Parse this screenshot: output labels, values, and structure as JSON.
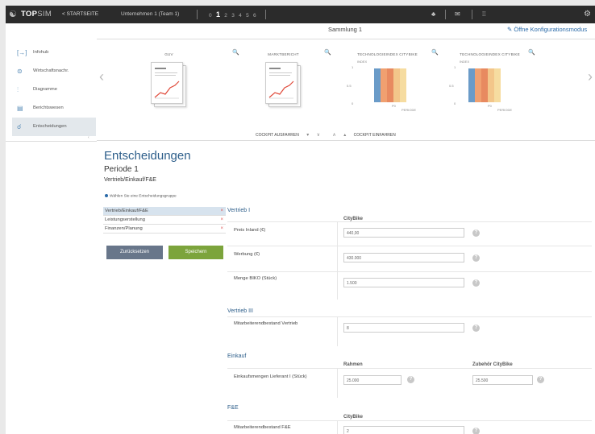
{
  "topbar": {
    "logo_icon": "people-icon",
    "logo_bold": "TOP",
    "logo_rest": "SIM",
    "start_link": "< STARTSEITE",
    "company": "Unternehmen 1 (Team 1)",
    "periods": [
      "0",
      "1",
      "2",
      "3",
      "4",
      "5",
      "6"
    ],
    "current_period": "1",
    "network_icon": "♣",
    "mail_icon": "✉",
    "chart_icon": "⁞⁞",
    "gear_icon": "⚙"
  },
  "collection": {
    "title": "Sammlung 1",
    "config_link": "✎ Öffne Konfigurationsmodus"
  },
  "sidebar": {
    "items": [
      {
        "icon": "[→]",
        "label": "Infohub"
      },
      {
        "icon": "⊜",
        "label": "Wirtschaftsnachr."
      },
      {
        "icon": "⫶",
        "label": "Diagramme"
      },
      {
        "icon": "▤",
        "label": "Berichtswesen"
      },
      {
        "icon": "☌",
        "label": "Entscheidungen"
      }
    ],
    "collapse": "‹"
  },
  "carousel": {
    "prev": "‹",
    "next": "›",
    "zoom_icon": "🔍",
    "cards": [
      {
        "title": "GUV"
      },
      {
        "title": "MARKTBERICHT"
      },
      {
        "title": "TECHNOLOGIEINDEX CITYBIKE",
        "ylabel": "INDEX",
        "xlabel": "PERIODE",
        "ticks": [
          "1",
          "0.5",
          "0"
        ],
        "xtick": "P0"
      },
      {
        "title": "TECHNOLOGIEINDEX CITYBIKE",
        "ylabel": "INDEX",
        "xlabel": "PERIODE",
        "ticks": [
          "1",
          "0.5",
          "0"
        ],
        "xtick": "P0"
      }
    ]
  },
  "cockpit": {
    "expand": "COCKPIT AUSFAHREN",
    "collapse": "COCKPIT EINFAHREN",
    "arrow_down": "▾",
    "chevron_down": "∨",
    "chevron_up": "∧",
    "arrow_up": "▴"
  },
  "main": {
    "title": "Entscheidungen",
    "period": "Periode 1",
    "section": "Vertrieb/Einkauf/F&E",
    "hint": "Wählen Sie eine Entscheidungsgruppe",
    "groups": [
      {
        "label": "Vertrieb/Einkauf/F&E",
        "active": true
      },
      {
        "label": "Leistungserstellung",
        "active": false
      },
      {
        "label": "Finanzen/Planung",
        "active": false
      }
    ],
    "remove_icon": "×",
    "back_button": "Zurücksetzen",
    "save_button": "Speichern"
  },
  "form": {
    "help_icon": "?",
    "sections": [
      {
        "title": "Vertrieb I",
        "columns": [
          "CityBike"
        ],
        "rows": [
          {
            "label": "Preis Inland (€)",
            "values": [
              "440,00"
            ]
          },
          {
            "label": "Werbung (€)",
            "values": [
              "430.000"
            ]
          },
          {
            "label": "Menge BIKO (Stück)",
            "values": [
              "1.500"
            ]
          }
        ]
      },
      {
        "title": "Vertrieb III",
        "columns": [],
        "rows": [
          {
            "label": "Mitarbeiterendbestand Vertrieb",
            "values": [
              "8"
            ]
          }
        ]
      },
      {
        "title": "Einkauf",
        "columns": [
          "Rahmen",
          "Zubehör CityBike"
        ],
        "rows": [
          {
            "label": "Einkaufsmengen Lieferant I (Stück)",
            "values": [
              "25.000",
              "25.500"
            ]
          }
        ]
      },
      {
        "title": "F&E",
        "columns": [
          "CityBike"
        ],
        "rows": [
          {
            "label": "Mitarbeiterendbestand F&E",
            "values": [
              "2"
            ]
          }
        ]
      }
    ]
  },
  "colors": {
    "topbar": "#2b2b2b",
    "accent": "#2d5e8a",
    "save": "#7ca43c",
    "reset": "#68768a",
    "bar_colors": [
      "#6a9bc8",
      "#f0a070",
      "#e88a60",
      "#f3c68a",
      "#f6dca0"
    ]
  }
}
